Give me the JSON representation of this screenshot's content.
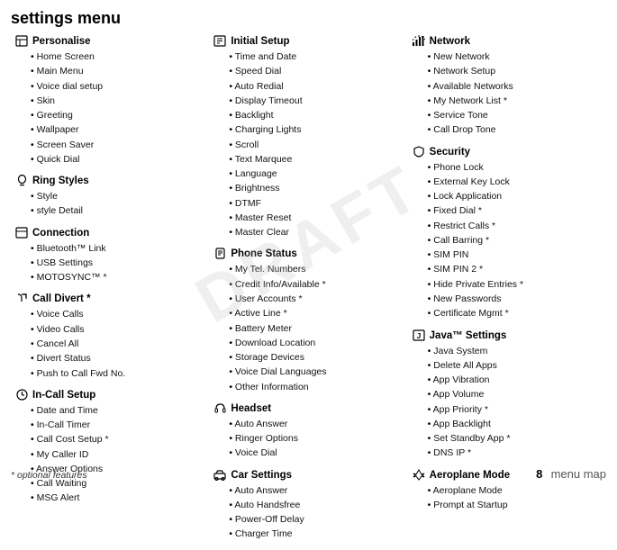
{
  "page": {
    "title": "settings menu",
    "draft_watermark": "DRAFT",
    "footnote": "* optional features",
    "page_label": "menu map",
    "page_number": "8"
  },
  "columns": [
    {
      "id": "col1",
      "sections": [
        {
          "id": "personalise",
          "icon": "person",
          "title": "Personalise",
          "items": [
            "Home Screen",
            "Main Menu",
            "Voice dial setup",
            "Skin",
            "Greeting",
            "Wallpaper",
            "Screen Saver",
            "Quick Dial"
          ]
        },
        {
          "id": "ring-styles",
          "icon": "ring",
          "title": "Ring Styles",
          "items": [
            "Style",
            "style Detail"
          ]
        },
        {
          "id": "connection",
          "icon": "connection",
          "title": "Connection",
          "items": [
            "Bluetooth™ Link",
            "USB Settings",
            "MOTOSYNC™ *"
          ]
        },
        {
          "id": "call-divert",
          "icon": "calldivert",
          "title": "Call Divert *",
          "items": [
            "Voice Calls",
            "Video Calls",
            "Cancel All",
            "Divert Status",
            "Push to Call Fwd No."
          ]
        },
        {
          "id": "in-call-setup",
          "icon": "incall",
          "title": "In-Call Setup",
          "items": [
            "Date and Time",
            "In-Call Timer",
            "Call Cost Setup *",
            "My Caller ID",
            "Answer Options",
            "Call Waiting",
            "MSG Alert"
          ]
        }
      ]
    },
    {
      "id": "col2",
      "sections": [
        {
          "id": "initial-setup",
          "icon": "initial",
          "title": "Initial Setup",
          "items": [
            "Time and Date",
            "Speed Dial",
            "Auto Redial",
            "Display Timeout",
            "Backlight",
            "Charging Lights",
            "Scroll",
            "Text Marquee",
            "Language",
            "Brightness",
            "DTMF",
            "Master Reset",
            "Master Clear"
          ]
        },
        {
          "id": "phone-status",
          "icon": "phonestatus",
          "title": "Phone Status",
          "items": [
            "My Tel. Numbers",
            "Credit Info/Available *",
            "User Accounts *",
            "Active Line *",
            "Battery Meter",
            "Download Location",
            "Storage Devices",
            "Voice Dial Languages",
            "Other Information"
          ]
        },
        {
          "id": "headset",
          "icon": "headset",
          "title": "Headset",
          "items": [
            "Auto Answer",
            "Ringer Options",
            "Voice Dial"
          ]
        },
        {
          "id": "car-settings",
          "icon": "car",
          "title": "Car Settings",
          "items": [
            "Auto Answer",
            "Auto Handsfree",
            "Power-Off Delay",
            "Charger Time"
          ]
        }
      ]
    },
    {
      "id": "col3",
      "sections": [
        {
          "id": "network",
          "icon": "network",
          "title": "Network",
          "items": [
            "New Network",
            "Network Setup",
            "Available Networks",
            "My Network List *",
            "Service Tone",
            "Call Drop Tone"
          ]
        },
        {
          "id": "security",
          "icon": "security",
          "title": "Security",
          "items": [
            "Phone Lock",
            "External Key Lock",
            "Lock Application",
            "Fixed Dial *",
            "Restrict Calls *",
            "Call Barring *",
            "SIM PIN",
            "SIM PIN 2 *",
            "Hide Private Entries *",
            "New Passwords",
            "Certificate Mgmt *"
          ]
        },
        {
          "id": "java-settings",
          "icon": "java",
          "title": "Java™ Settings",
          "items": [
            "Java System",
            "Delete All Apps",
            "App Vibration",
            "App Volume",
            "App Priority *",
            "App Backlight",
            "Set Standby App *",
            "DNS IP *"
          ]
        },
        {
          "id": "aeroplane-mode",
          "icon": "aeroplane",
          "title": "Aeroplane Mode",
          "items": [
            "Aeroplane Mode",
            "Prompt at Startup"
          ]
        }
      ]
    }
  ]
}
